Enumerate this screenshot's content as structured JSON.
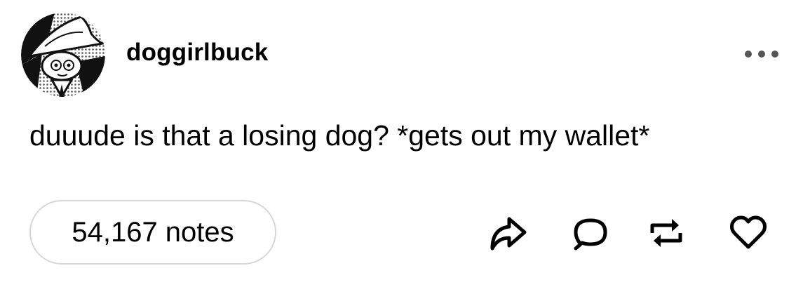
{
  "post": {
    "username": "doggirlbuck",
    "text": "duuude is that a losing dog? *gets out my wallet*",
    "notes_label": "54,167 notes"
  },
  "icons": {
    "avatar": "avatar-image",
    "more": "more-options-icon",
    "share": "share-arrow-icon",
    "reply": "speech-bubble-icon",
    "reblog": "reblog-icon",
    "like": "heart-icon"
  },
  "colors": {
    "text": "#000000",
    "pill_border": "#d7d7d7",
    "background": "#ffffff"
  }
}
